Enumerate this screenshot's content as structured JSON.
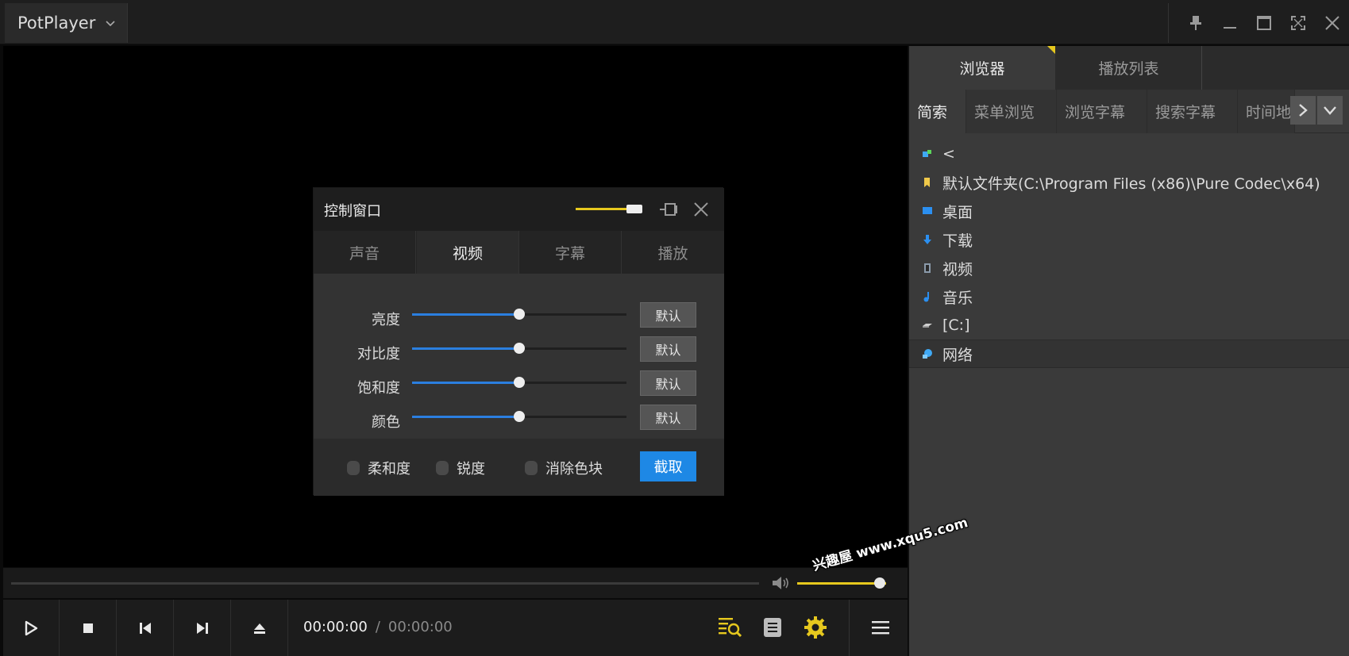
{
  "app": {
    "name": "PotPlayer"
  },
  "colors": {
    "accent_yellow": "#e6c81e",
    "accent_blue": "#1e88e5",
    "slider_blue": "#2b7fe0",
    "bg_dark": "#1e1e1e"
  },
  "window_controls": [
    {
      "icon": "pin-icon"
    },
    {
      "icon": "minimize-icon"
    },
    {
      "icon": "maximize-icon"
    },
    {
      "icon": "fullscreen-icon"
    },
    {
      "icon": "close-icon"
    }
  ],
  "player": {
    "time_current": "00:00:00",
    "time_separator": "/",
    "time_total": "00:00:00",
    "seek_progress": 0,
    "volume": 0.93
  },
  "panel": {
    "tabs": [
      {
        "label": "浏览器",
        "active": true
      },
      {
        "label": "播放列表",
        "active": false
      }
    ],
    "subtabs": [
      {
        "label": "简索",
        "active": true
      },
      {
        "label": "菜单浏览",
        "active": false
      },
      {
        "label": "浏览字幕",
        "active": false
      },
      {
        "label": "搜索字幕",
        "active": false
      },
      {
        "label": "时间地",
        "active": false
      }
    ],
    "files": [
      {
        "label": "<",
        "icon": "up-icon"
      },
      {
        "label": "默认文件夹(C:\\Program Files (x86)\\Pure Codec\\x64)",
        "icon": "folder-icon"
      },
      {
        "label": "桌面",
        "icon": "desktop-icon"
      },
      {
        "label": "下载",
        "icon": "download-icon"
      },
      {
        "label": "视频",
        "icon": "video-icon"
      },
      {
        "label": "音乐",
        "icon": "music-icon"
      },
      {
        "label": "[C:]",
        "icon": "drive-icon"
      },
      {
        "label": "网络",
        "icon": "network-icon",
        "selected": true
      }
    ]
  },
  "dialog": {
    "title": "控制窗口",
    "opacity": 0.85,
    "tabs": [
      {
        "label": "声音",
        "active": false
      },
      {
        "label": "视频",
        "active": true
      },
      {
        "label": "字幕",
        "active": false
      },
      {
        "label": "播放",
        "active": false
      }
    ],
    "sliders": [
      {
        "label": "亮度",
        "value": 0.5,
        "default_label": "默认"
      },
      {
        "label": "对比度",
        "value": 0.5,
        "default_label": "默认"
      },
      {
        "label": "饱和度",
        "value": 0.5,
        "default_label": "默认"
      },
      {
        "label": "颜色",
        "value": 0.5,
        "default_label": "默认"
      }
    ],
    "checkboxes": [
      {
        "label": "柔和度",
        "checked": false
      },
      {
        "label": "锐度",
        "checked": false
      },
      {
        "label": "消除色块",
        "checked": false
      }
    ],
    "capture_label": "截取"
  },
  "watermark": {
    "text": "兴趣屋 www.xqu5.com"
  }
}
